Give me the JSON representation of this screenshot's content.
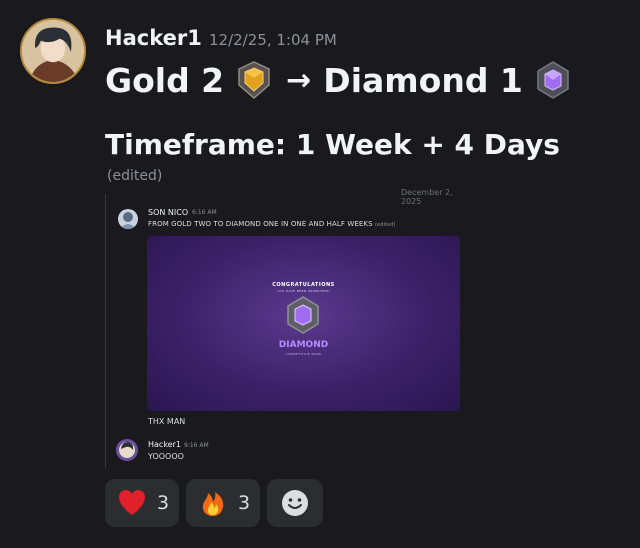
{
  "message": {
    "author": "Hacker1",
    "timestamp": "12/2/25, 1:04 PM",
    "from_rank": "Gold 2",
    "arrow": "→",
    "to_rank": "Diamond 1",
    "timeframe": "Timeframe: 1 Week + 4 Days",
    "edited": "(edited)"
  },
  "embed": {
    "top_text": "December 2, 2025",
    "first": {
      "author": "SON NICO",
      "time": "6:16 AM",
      "text": "FROM GOLD TWO TO DIAMOND ONE IN ONE AND HALF WEEKS",
      "edited": "(edited)"
    },
    "promo": {
      "title": "CONGRATULATIONS",
      "subtitle": "YOU HAVE BEEN PROMOTED!",
      "rank": "DIAMOND",
      "rank_sub": "COMPETITIVE RANK"
    },
    "thx": "THX MAN",
    "reply": {
      "author": "Hacker1",
      "time": "9:16 AM",
      "text": "YOOOOO"
    }
  },
  "reactions": [
    {
      "emoji": "heart",
      "count": "3"
    },
    {
      "emoji": "fire",
      "count": "3"
    }
  ],
  "colors": {
    "background": "#1a1a1e",
    "reaction_bg": "#2b2d31",
    "diamond": "#b58cff",
    "gold": "#e2a21f"
  }
}
